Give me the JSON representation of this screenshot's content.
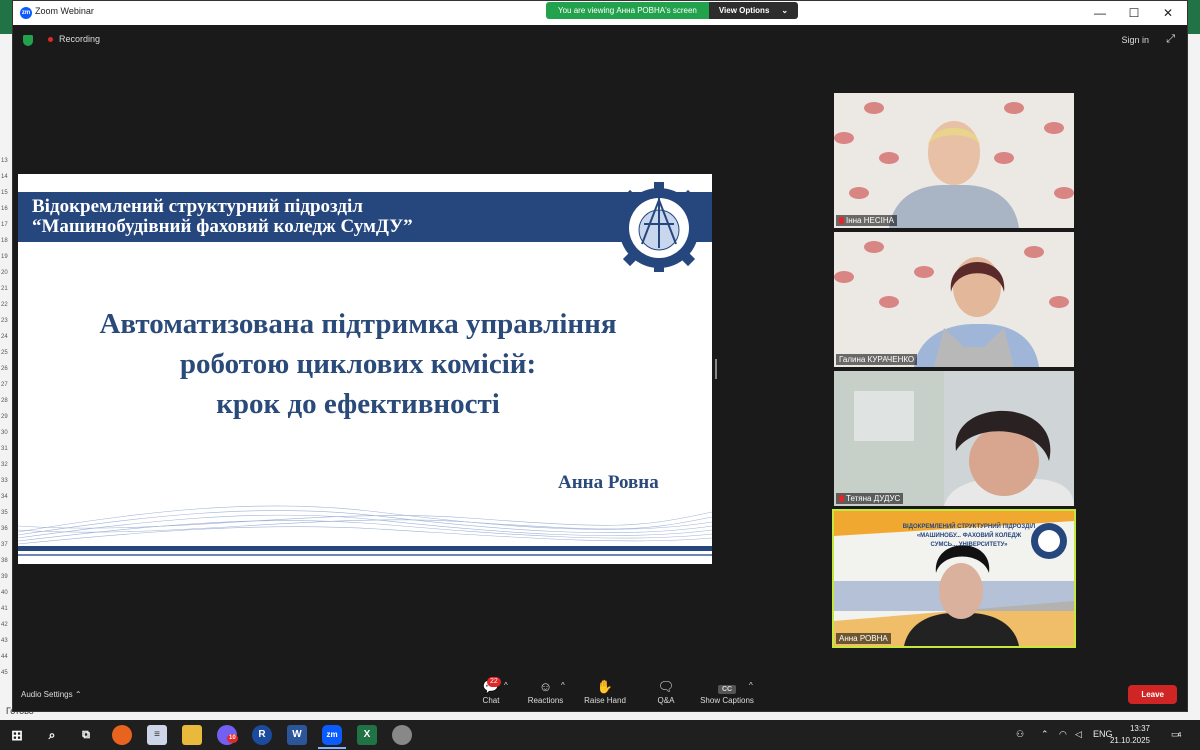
{
  "window": {
    "title": "Zoom Webinar",
    "viewing_banner": "You are viewing Анна РОВНА's screen",
    "view_options": "View Options",
    "minimize": "—",
    "maximize": "☐",
    "close": "✕"
  },
  "topbar": {
    "recording": "Recording",
    "sign_in": "Sign in"
  },
  "slide": {
    "institution_line1": "Відокремлений структурний підрозділ",
    "institution_line2": "“Машинобудівний фаховий коледж СумДУ”",
    "title_line1": "Автоматизована підтримка управління",
    "title_line2": "роботою циклових комісій:",
    "title_line3": "крок до ефективності",
    "author": "Анна Ровна"
  },
  "participants": [
    {
      "name": "Інна НЕСІНА",
      "muted": true
    },
    {
      "name": "Галина КУРАЧЕНКО",
      "muted": false
    },
    {
      "name": "Тетяна ДУДУС",
      "muted": true
    },
    {
      "name": "Анна РОВНА",
      "muted": false,
      "active": true,
      "bg_line1": "ВІДОКРЕМЛЕНИЙ СТРУКТУРНИЙ ПІДРОЗДІЛ",
      "bg_line2": "«МАШИНОБУ... ФАХОВИЙ КОЛЕДЖ",
      "bg_line3": "СУМСЬ... УНІВЕРСИТЕТУ»"
    }
  ],
  "toolbar": {
    "audio_settings": "Audio Settings",
    "chat": "Chat",
    "chat_badge": "22",
    "reactions": "Reactions",
    "raise_hand": "Raise Hand",
    "qa": "Q&A",
    "show_captions": "Show Captions",
    "cc": "CC",
    "leave": "Leave"
  },
  "background_app": {
    "status": "Готово",
    "row_numbers": [
      "13",
      "14",
      "15",
      "16",
      "17",
      "18",
      "19",
      "20",
      "21",
      "22",
      "23",
      "24",
      "25",
      "26",
      "27",
      "28",
      "29",
      "30",
      "31",
      "32",
      "33",
      "34",
      "35",
      "36",
      "37",
      "38",
      "39",
      "40",
      "41",
      "42",
      "43",
      "44",
      "45"
    ]
  },
  "taskbar": {
    "time": "13:37",
    "date": "21.10.2025",
    "language": "ENG",
    "notification_count": "4",
    "viber_badge": "10"
  },
  "colors": {
    "accent_green": "#23a24d",
    "leave_red": "#cf2525",
    "slide_blue": "#26477e",
    "active_border": "#c6e83a"
  }
}
